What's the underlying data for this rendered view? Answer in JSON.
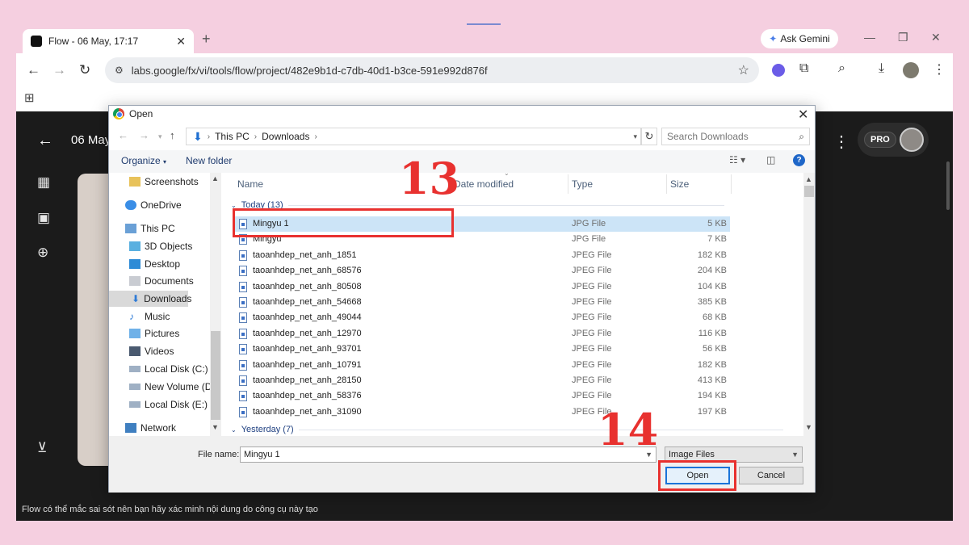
{
  "browser": {
    "tab_title": "Flow - 06 May, 17:17",
    "new_tab": "+",
    "ask_gemini": "Ask Gemini",
    "url": "labs.google/fx/vi/tools/flow/project/482e9b1d-c7db-40d1-b3ce-591e992d876f"
  },
  "page": {
    "title": "06 May",
    "pro_badge": "PRO",
    "footer": "Flow có thể mắc sai sót nên bạn hãy xác minh nội dung do công cụ này tạo"
  },
  "dialog": {
    "title": "Open",
    "breadcrumb": [
      "This PC",
      "Downloads"
    ],
    "search_placeholder": "Search Downloads",
    "organize": "Organize",
    "new_folder": "New folder",
    "columns": {
      "name": "Name",
      "date": "Date modified",
      "type": "Type",
      "size": "Size"
    },
    "nav_items": [
      "Screenshots",
      "OneDrive",
      "This PC",
      "3D Objects",
      "Desktop",
      "Documents",
      "Downloads",
      "Music",
      "Pictures",
      "Videos",
      "Local Disk (C:)",
      "New Volume (D:)",
      "Local Disk (E:)",
      "Network"
    ],
    "groups": {
      "today": "Today (13)",
      "yesterday": "Yesterday (7)"
    },
    "files": [
      {
        "name": "Mingyu 1",
        "type": "JPG File",
        "size": "5 KB"
      },
      {
        "name": "Mingyu",
        "type": "JPG File",
        "size": "7 KB"
      },
      {
        "name": "taoanhdep_net_anh_1851",
        "type": "JPEG File",
        "size": "182 KB"
      },
      {
        "name": "taoanhdep_net_anh_68576",
        "type": "JPEG File",
        "size": "204 KB"
      },
      {
        "name": "taoanhdep_net_anh_80508",
        "type": "JPEG File",
        "size": "104 KB"
      },
      {
        "name": "taoanhdep_net_anh_54668",
        "type": "JPEG File",
        "size": "385 KB"
      },
      {
        "name": "taoanhdep_net_anh_49044",
        "type": "JPEG File",
        "size": "68 KB"
      },
      {
        "name": "taoanhdep_net_anh_12970",
        "type": "JPEG File",
        "size": "116 KB"
      },
      {
        "name": "taoanhdep_net_anh_93701",
        "type": "JPEG File",
        "size": "56 KB"
      },
      {
        "name": "taoanhdep_net_anh_10791",
        "type": "JPEG File",
        "size": "182 KB"
      },
      {
        "name": "taoanhdep_net_anh_28150",
        "type": "JPEG File",
        "size": "413 KB"
      },
      {
        "name": "taoanhdep_net_anh_58376",
        "type": "JPEG File",
        "size": "194 KB"
      },
      {
        "name": "taoanhdep_net_anh_31090",
        "type": "JPEG File",
        "size": "197 KB"
      }
    ],
    "file_name_label": "File name:",
    "file_name_value": "Mingyu 1",
    "file_type": "Image Files",
    "open_button": "Open",
    "cancel_button": "Cancel"
  },
  "annotations": {
    "step_13": "13",
    "step_14": "14"
  },
  "colors": {
    "annotation_red": "#e8312f",
    "selection_blue": "#cce4f7",
    "page_bg": "#f5cfe0"
  }
}
